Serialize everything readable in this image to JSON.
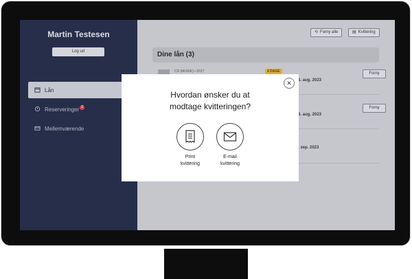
{
  "sidebar": {
    "user_name": "Martin Testesen",
    "logout_label": "Log ud",
    "items": [
      {
        "label": "Lån",
        "icon": "calendar-icon"
      },
      {
        "label": "Reserveringer",
        "icon": "reservations-icon",
        "badge": "2"
      },
      {
        "label": "Mellemværende",
        "icon": "card-icon"
      }
    ]
  },
  "toolbar": {
    "renew_all_label": "Forny alle",
    "receipt_label": "Kvittering"
  },
  "loans": {
    "title": "Dine lån (3)",
    "rows": [
      {
        "meta": "CD (MUSIK) • 2017",
        "badge": "4 DAGE",
        "date": "5. aug. 2023",
        "renew_label": "Forny"
      },
      {
        "date": "8. aug. 2023",
        "renew_label": "Forny"
      },
      {
        "date": ". sep. 2023"
      }
    ]
  },
  "modal": {
    "title_line1": "Hvordan ønsker du at",
    "title_line2": "modtage kvitteringen?",
    "close_symbol": "✕",
    "options": [
      {
        "line1": "Print",
        "line2": "kvittering",
        "icon": "receipt-icon"
      },
      {
        "line1": "E-mail",
        "line2": "kvittering",
        "icon": "envelope-icon"
      }
    ]
  },
  "colors": {
    "sidebar_bg": "#262e4a",
    "overlay_bg": "#c6c6cd",
    "badge_red": "#d0464a",
    "due_badge": "#dcae3a"
  }
}
